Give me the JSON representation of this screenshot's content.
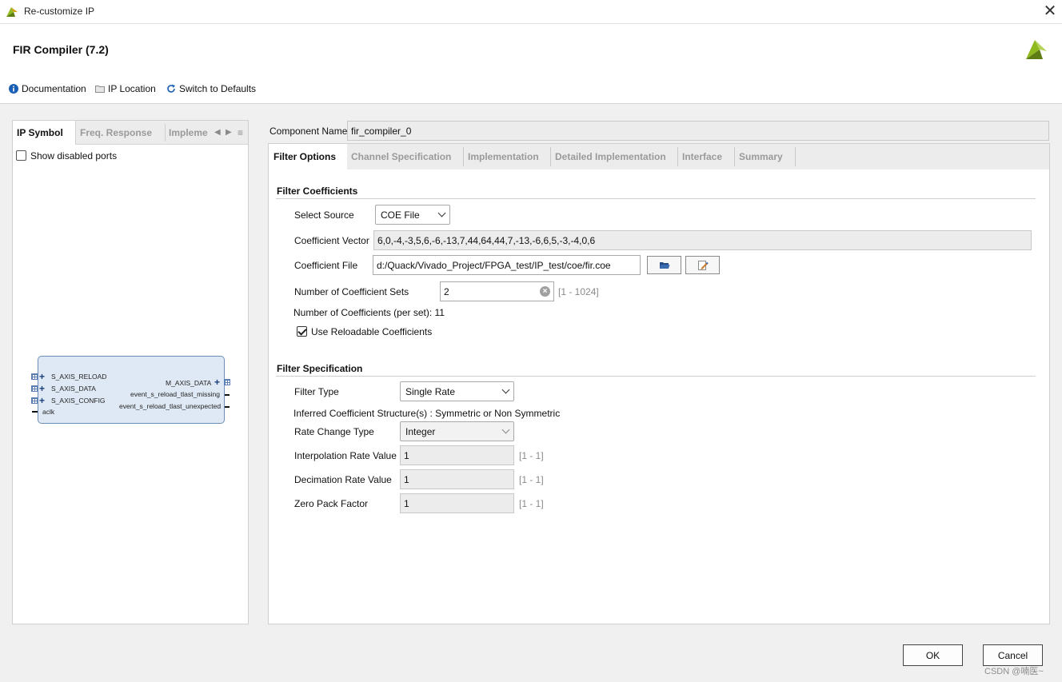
{
  "window": {
    "title": "Re-customize IP",
    "close_symbol": "✕"
  },
  "header": {
    "ip_title": "FIR Compiler (7.2)"
  },
  "toolbar": {
    "documentation": "Documentation",
    "ip_location": "IP Location",
    "switch_defaults": "Switch to Defaults"
  },
  "left_panel": {
    "tabs": [
      "IP Symbol",
      "Freq. Response",
      "Impleme"
    ],
    "show_disabled_ports": {
      "label": "Show disabled ports",
      "checked": false
    },
    "ip_symbol": {
      "inputs": [
        "S_AXIS_RELOAD",
        "S_AXIS_DATA",
        "S_AXIS_CONFIG",
        "aclk"
      ],
      "outputs": [
        "M_AXIS_DATA",
        "event_s_reload_tlast_missing",
        "event_s_reload_tlast_unexpected"
      ]
    }
  },
  "component": {
    "label": "Component Name",
    "value": "fir_compiler_0"
  },
  "tabs": [
    "Filter Options",
    "Channel Specification",
    "Implementation",
    "Detailed Implementation",
    "Interface",
    "Summary"
  ],
  "filter_coefficients": {
    "title": "Filter Coefficients",
    "select_source": {
      "label": "Select Source",
      "value": "COE File"
    },
    "coefficient_vector": {
      "label": "Coefficient Vector",
      "value": "6,0,-4,-3,5,6,-6,-13,7,44,64,44,7,-13,-6,6,5,-3,-4,0,6"
    },
    "coefficient_file": {
      "label": "Coefficient File",
      "value": "d:/Quack/Vivado_Project/FPGA_test/IP_test/coe/fir.coe"
    },
    "num_sets": {
      "label": "Number of Coefficient Sets",
      "value": "2",
      "range": "[1 - 1024]"
    },
    "num_coeffs": "Number of Coefficients (per set): 11",
    "reloadable": {
      "label": "Use Reloadable Coefficients",
      "checked": true
    }
  },
  "filter_specification": {
    "title": "Filter Specification",
    "filter_type": {
      "label": "Filter Type",
      "value": "Single Rate"
    },
    "inferred": "Inferred Coefficient Structure(s) : Symmetric or Non Symmetric",
    "rate_change": {
      "label": "Rate Change Type",
      "value": "Integer"
    },
    "interpolation": {
      "label": "Interpolation Rate Value",
      "value": "1",
      "range": "[1 - 1]"
    },
    "decimation": {
      "label": "Decimation Rate Value",
      "value": "1",
      "range": "[1 - 1]"
    },
    "zero_pack": {
      "label": "Zero Pack Factor",
      "value": "1",
      "range": "[1 - 1]"
    }
  },
  "buttons": {
    "ok": "OK",
    "cancel": "Cancel"
  },
  "watermark": "CSDN @喃医~",
  "colors": {
    "accent_blue": "#1a5fb4",
    "brand_green": "#8fb91f",
    "brand_dark": "#5f7d14"
  }
}
